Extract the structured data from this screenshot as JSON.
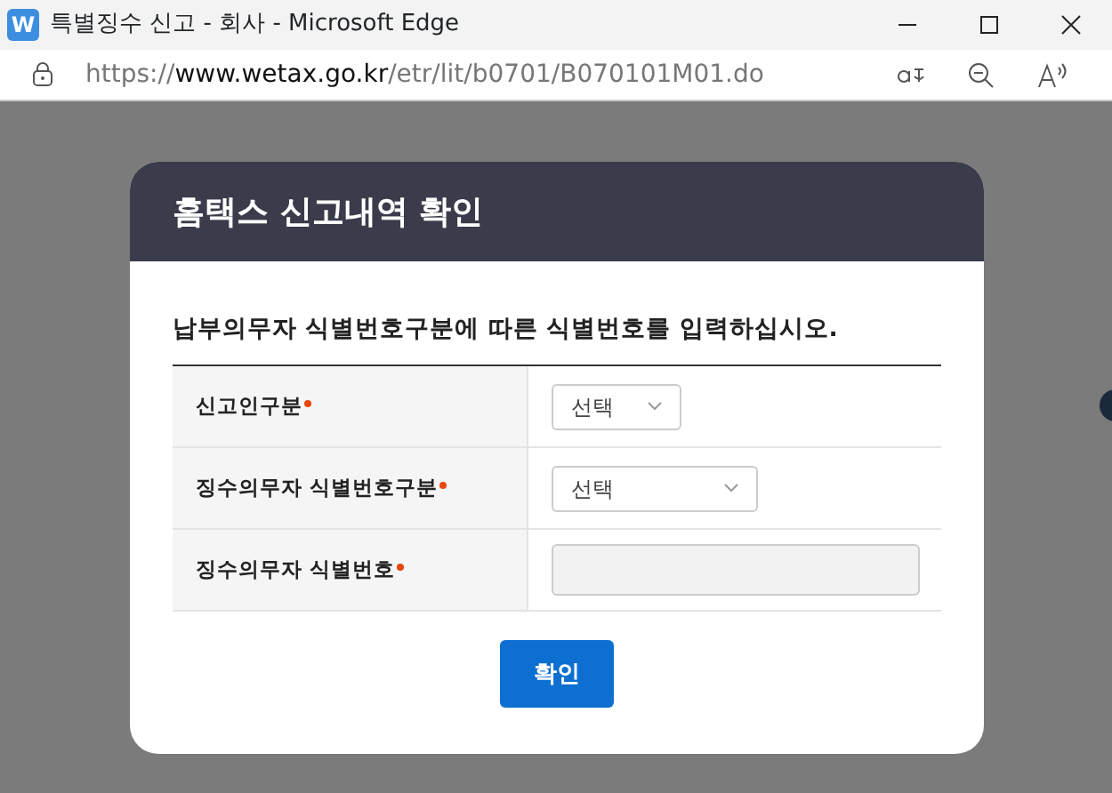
{
  "window": {
    "title": "특별징수 신고 - 회사 - Microsoft Edge",
    "app_icon": "W"
  },
  "address_bar": {
    "scheme": "https://",
    "domain": "www.wetax.go.kr",
    "path": "/etr/lit/b0701/B070101M01.do"
  },
  "dialog": {
    "title": "홈택스 신고내역 확인",
    "instruction": "납부의무자 식별번호구분에 따른 식별번호를 입력하십시오.",
    "rows": [
      {
        "label": "신고인구분",
        "required": true,
        "kind": "select",
        "value": "선택",
        "wide": false
      },
      {
        "label": "징수의무자 식별번호구분",
        "required": true,
        "kind": "select",
        "value": "선택",
        "wide": true
      },
      {
        "label": "징수의무자 식별번호",
        "required": true,
        "kind": "input",
        "disabled": true
      }
    ],
    "confirm_button": "확인"
  }
}
